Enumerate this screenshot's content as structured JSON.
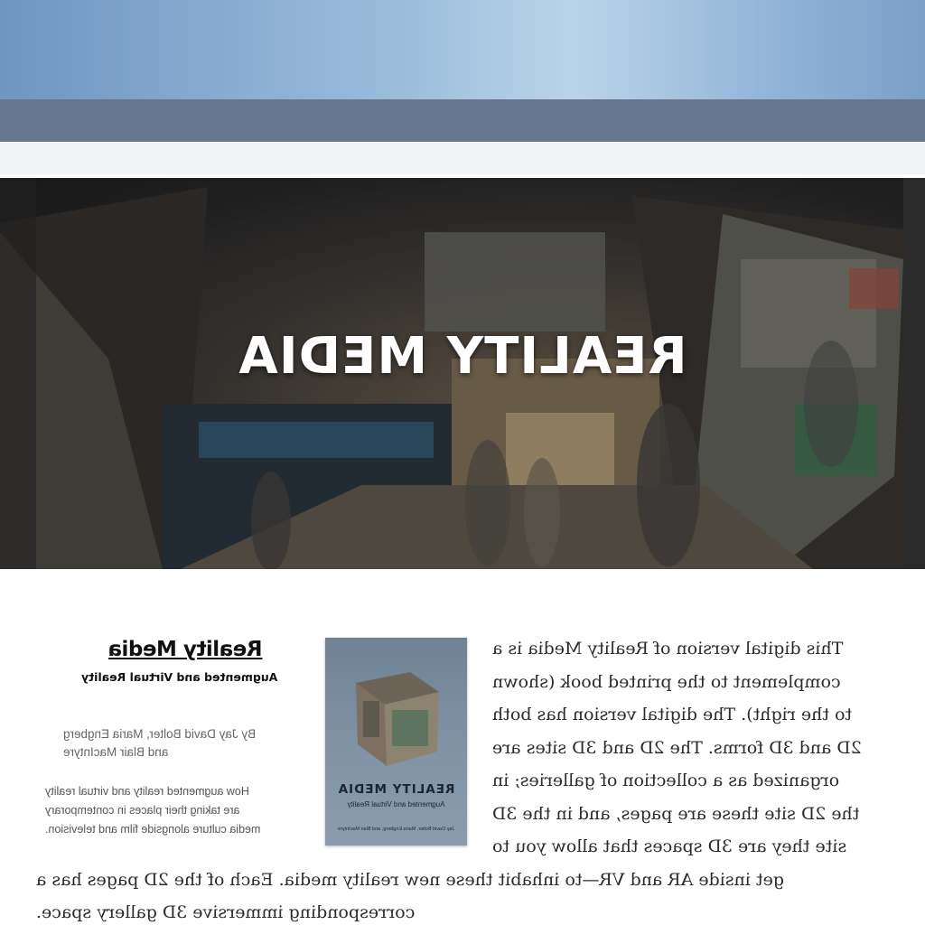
{
  "hero": {
    "title": "REALITY MEDIA"
  },
  "book": {
    "title": "Reality Media",
    "subtitle": "Augmented and Virtual Reality",
    "authors_line1": "By Jay David Bolter, Maria Engberg",
    "authors_line2": "and Blair MacIntyre",
    "description_line1": "How augmented reality and virtual reality",
    "description_line2": "are taking their places in contemporary",
    "description_line3": "media culture alongside film and television."
  },
  "cover": {
    "title": "REALITY MEDIA",
    "subtitle": "Augmented and Virtual Reality",
    "authors": "Jay David Bolter, Maria Engberg, and Blair MacIntyre"
  },
  "intro": {
    "line1": "This digital version of Reality Media is a",
    "line2": "complement to the printed book (shown",
    "line3": "to the right). The digital version has both",
    "line4": "2D and 3D forms. The 2D and 3D sites are",
    "line5": "organized as a collection of galleries; in",
    "line6": "the 2D site these are pages, and in the 3D",
    "line7": "site they are 3D spaces that allow you to",
    "line8": "get inside AR and VR—to inhabit these new reality media. Each of the 2D pages has a",
    "line9": "corresponding immersive 3D gallery space."
  },
  "colors": {
    "nav_band": "#66768c",
    "light_band": "#f1f3f5",
    "top_gradient_mid": "#b9d4ea"
  }
}
